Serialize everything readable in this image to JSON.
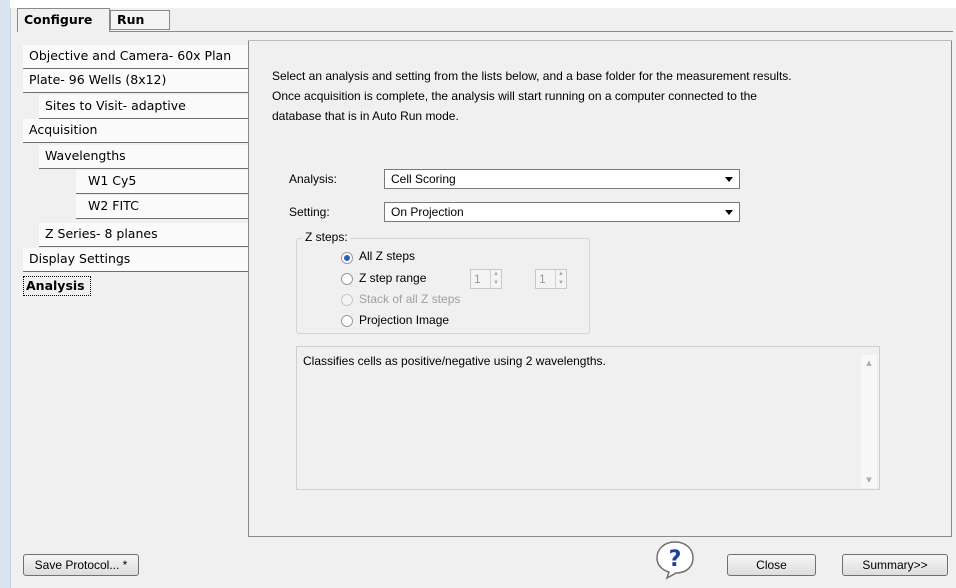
{
  "tabs": {
    "configure": "Configure",
    "run": "Run"
  },
  "nav": {
    "items": [
      {
        "label": "Objective and Camera- 60x Plan"
      },
      {
        "label": "Plate- 96 Wells (8x12)"
      },
      {
        "label": "Sites to Visit- adaptive"
      },
      {
        "label": "Acquisition"
      },
      {
        "label": "Wavelengths"
      },
      {
        "label": "W1 Cy5"
      },
      {
        "label": "W2 FITC"
      },
      {
        "label": "Z Series- 8 planes"
      },
      {
        "label": "Display Settings"
      },
      {
        "label": "Analysis"
      }
    ]
  },
  "intro": {
    "line1": "Select an analysis and setting from the lists below, and a base folder for the measurement results.",
    "line2": "Once acquisition is complete, the analysis will start running on a computer connected to the",
    "line3": "database that is in Auto Run mode."
  },
  "analysis": {
    "label": "Analysis:",
    "value": "Cell Scoring"
  },
  "setting": {
    "label": "Setting:",
    "value": "On Projection"
  },
  "zsteps": {
    "title": "Z steps:",
    "all": "All Z steps",
    "range": "Z step range",
    "range_from": "1",
    "range_to": "1",
    "stack": "Stack of all Z steps",
    "projection": "Projection Image"
  },
  "description": "Classifies cells as positive/negative using 2 wavelengths.",
  "buttons": {
    "save": "Save Protocol... *",
    "close": "Close",
    "summary": "Summary>>"
  },
  "colors": {
    "accent": "#2b5fb8",
    "help_fill": "#1f3f9e"
  }
}
